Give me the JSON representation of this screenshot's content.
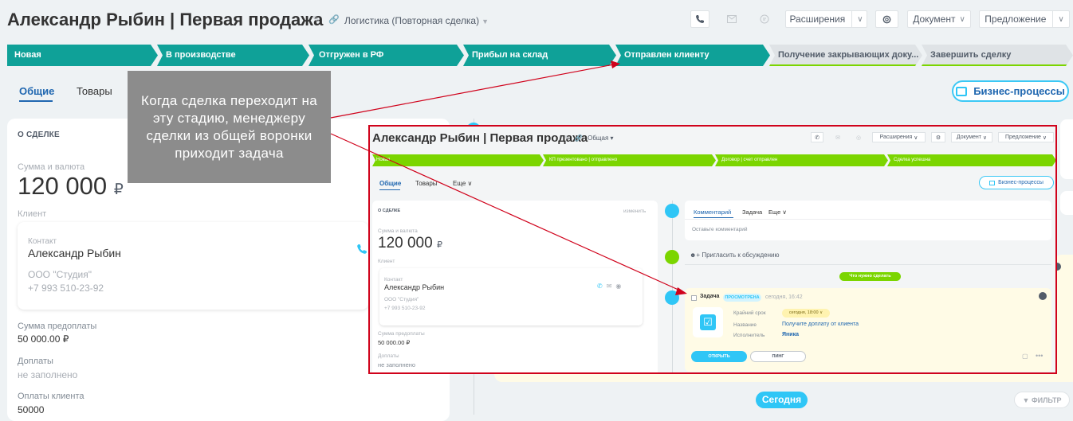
{
  "header": {
    "title": "Александр Рыбин | Первая продажа",
    "funnel": "Логистика (Повторная сделка)",
    "buttons": {
      "extensions": "Расширения",
      "document": "Документ",
      "offer": "Предложение"
    }
  },
  "stages": [
    {
      "label": "Новая",
      "state": "done"
    },
    {
      "label": "В производстве",
      "state": "done"
    },
    {
      "label": "Отгружен в РФ",
      "state": "done"
    },
    {
      "label": "Прибыл на склад",
      "state": "done"
    },
    {
      "label": "Отправлен клиенту",
      "state": "done"
    },
    {
      "label": "Получение закрывающих доку...",
      "state": "todo"
    },
    {
      "label": "Завершить сделку",
      "state": "todo"
    }
  ],
  "tabs": {
    "general": "Общие",
    "goods": "Товары"
  },
  "business_processes": "Бизнес-процессы",
  "deal": {
    "section_title": "О СДЕЛКЕ",
    "amount_label": "Сумма и валюта",
    "amount": "120 000",
    "currency": "₽",
    "client_label": "Клиент",
    "contact_label": "Контакт",
    "contact_name": "Александр Рыбин",
    "company": "ООО \"Студия\"",
    "phone": "+7 993 510-23-92",
    "prepay_label": "Сумма предоплаты",
    "prepay": "50 000.00 ₽",
    "surcharge_label": "Доплаты",
    "surcharge": "не заполнено",
    "client_pay_label": "Оплаты клиента",
    "client_pay": "50000"
  },
  "timeline": {
    "today": "Сегодня",
    "filter": "ФИЛЬТР"
  },
  "callout": "Когда сделка переходит на эту стадию, менеджеру сделки из общей воронки приходит задача",
  "inset": {
    "title": "Александр Рыбин | Первая продажа",
    "funnel": "Общая",
    "buttons": {
      "extensions": "Расширения",
      "document": "Документ",
      "offer": "Предложение"
    },
    "stages": [
      "Новая",
      "КП презентовано | отправлено",
      "Договор | счет отправлен",
      "Сделка успешна"
    ],
    "tabs": {
      "general": "Общие",
      "goods": "Товары",
      "more": "Еще"
    },
    "business_processes": "Бизнес-процессы",
    "section_title": "О СДЕЛКЕ",
    "edit": "изменить",
    "amount_label": "Сумма и валюта",
    "amount": "120 000",
    "currency": "₽",
    "client_label": "Клиент",
    "contact_label": "Контакт",
    "contact_name": "Александр Рыбин",
    "company": "ООО \"Студия\"",
    "phone": "+7 993 510-23-92",
    "prepay_label": "Сумма предоплаты",
    "prepay": "50 000.00 ₽",
    "surcharge_label": "Доплаты",
    "surcharge": "не заполнено",
    "comment_tab": "Комментарий",
    "task_tab": "Задача",
    "more_tab": "Еще",
    "comment_placeholder": "Оставьте комментарий",
    "invite": "Пригласить к обсуждению",
    "todo_pill": "Что нужно сделать",
    "task_label": "Задача",
    "task_status": "ПРОСМОТРЕНА",
    "task_time": "сегодня, 16:42",
    "deadline_label": "Крайний срок",
    "deadline_value": "сегодня, 18:00",
    "name_label": "Название",
    "name_value": "Получите доплату от клиента",
    "executor_label": "Исполнитель",
    "executor_value": "Яника",
    "open_button": "ОТКРЫТЬ",
    "ping_button": "ПИНГ"
  },
  "colors": {
    "stage_done": "#0fa198",
    "stage_inset": "#7bd500",
    "accent": "#2fc6f6",
    "arrow": "#d0021b"
  }
}
